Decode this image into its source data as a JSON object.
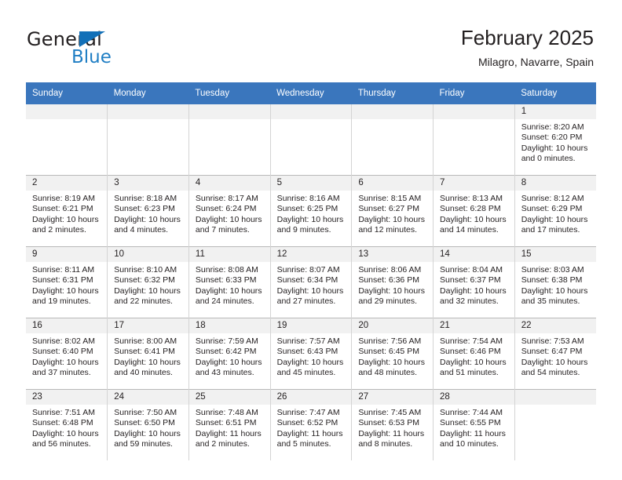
{
  "brand": {
    "name_part1": "General",
    "name_part2": "Blue",
    "triangle_icon": "blue-triangle-icon",
    "color_primary": "#1270b8",
    "color_secondary": "#1f7ec4"
  },
  "header": {
    "title": "February 2025",
    "subtitle": "Milagro, Navarre, Spain"
  },
  "calendar": {
    "header_bg": "#3a76bd",
    "header_text_color": "#ffffff",
    "daynum_bg": "#f1f1f1",
    "weekdays": [
      "Sunday",
      "Monday",
      "Tuesday",
      "Wednesday",
      "Thursday",
      "Friday",
      "Saturday"
    ],
    "labels": {
      "sunrise": "Sunrise:",
      "sunset": "Sunset:",
      "daylight": "Daylight:"
    },
    "weeks": [
      [
        {
          "day": "",
          "blank": true,
          "sunrise": "",
          "sunset": "",
          "daylight_line1": "",
          "daylight_line2": ""
        },
        {
          "day": "",
          "blank": true,
          "sunrise": "",
          "sunset": "",
          "daylight_line1": "",
          "daylight_line2": ""
        },
        {
          "day": "",
          "blank": true,
          "sunrise": "",
          "sunset": "",
          "daylight_line1": "",
          "daylight_line2": ""
        },
        {
          "day": "",
          "blank": true,
          "sunrise": "",
          "sunset": "",
          "daylight_line1": "",
          "daylight_line2": ""
        },
        {
          "day": "",
          "blank": true,
          "sunrise": "",
          "sunset": "",
          "daylight_line1": "",
          "daylight_line2": ""
        },
        {
          "day": "",
          "blank": true,
          "sunrise": "",
          "sunset": "",
          "daylight_line1": "",
          "daylight_line2": ""
        },
        {
          "day": "1",
          "blank": false,
          "sunrise": "Sunrise: 8:20 AM",
          "sunset": "Sunset: 6:20 PM",
          "daylight_line1": "Daylight: 10 hours",
          "daylight_line2": "and 0 minutes."
        }
      ],
      [
        {
          "day": "2",
          "blank": false,
          "sunrise": "Sunrise: 8:19 AM",
          "sunset": "Sunset: 6:21 PM",
          "daylight_line1": "Daylight: 10 hours",
          "daylight_line2": "and 2 minutes."
        },
        {
          "day": "3",
          "blank": false,
          "sunrise": "Sunrise: 8:18 AM",
          "sunset": "Sunset: 6:23 PM",
          "daylight_line1": "Daylight: 10 hours",
          "daylight_line2": "and 4 minutes."
        },
        {
          "day": "4",
          "blank": false,
          "sunrise": "Sunrise: 8:17 AM",
          "sunset": "Sunset: 6:24 PM",
          "daylight_line1": "Daylight: 10 hours",
          "daylight_line2": "and 7 minutes."
        },
        {
          "day": "5",
          "blank": false,
          "sunrise": "Sunrise: 8:16 AM",
          "sunset": "Sunset: 6:25 PM",
          "daylight_line1": "Daylight: 10 hours",
          "daylight_line2": "and 9 minutes."
        },
        {
          "day": "6",
          "blank": false,
          "sunrise": "Sunrise: 8:15 AM",
          "sunset": "Sunset: 6:27 PM",
          "daylight_line1": "Daylight: 10 hours",
          "daylight_line2": "and 12 minutes."
        },
        {
          "day": "7",
          "blank": false,
          "sunrise": "Sunrise: 8:13 AM",
          "sunset": "Sunset: 6:28 PM",
          "daylight_line1": "Daylight: 10 hours",
          "daylight_line2": "and 14 minutes."
        },
        {
          "day": "8",
          "blank": false,
          "sunrise": "Sunrise: 8:12 AM",
          "sunset": "Sunset: 6:29 PM",
          "daylight_line1": "Daylight: 10 hours",
          "daylight_line2": "and 17 minutes."
        }
      ],
      [
        {
          "day": "9",
          "blank": false,
          "sunrise": "Sunrise: 8:11 AM",
          "sunset": "Sunset: 6:31 PM",
          "daylight_line1": "Daylight: 10 hours",
          "daylight_line2": "and 19 minutes."
        },
        {
          "day": "10",
          "blank": false,
          "sunrise": "Sunrise: 8:10 AM",
          "sunset": "Sunset: 6:32 PM",
          "daylight_line1": "Daylight: 10 hours",
          "daylight_line2": "and 22 minutes."
        },
        {
          "day": "11",
          "blank": false,
          "sunrise": "Sunrise: 8:08 AM",
          "sunset": "Sunset: 6:33 PM",
          "daylight_line1": "Daylight: 10 hours",
          "daylight_line2": "and 24 minutes."
        },
        {
          "day": "12",
          "blank": false,
          "sunrise": "Sunrise: 8:07 AM",
          "sunset": "Sunset: 6:34 PM",
          "daylight_line1": "Daylight: 10 hours",
          "daylight_line2": "and 27 minutes."
        },
        {
          "day": "13",
          "blank": false,
          "sunrise": "Sunrise: 8:06 AM",
          "sunset": "Sunset: 6:36 PM",
          "daylight_line1": "Daylight: 10 hours",
          "daylight_line2": "and 29 minutes."
        },
        {
          "day": "14",
          "blank": false,
          "sunrise": "Sunrise: 8:04 AM",
          "sunset": "Sunset: 6:37 PM",
          "daylight_line1": "Daylight: 10 hours",
          "daylight_line2": "and 32 minutes."
        },
        {
          "day": "15",
          "blank": false,
          "sunrise": "Sunrise: 8:03 AM",
          "sunset": "Sunset: 6:38 PM",
          "daylight_line1": "Daylight: 10 hours",
          "daylight_line2": "and 35 minutes."
        }
      ],
      [
        {
          "day": "16",
          "blank": false,
          "sunrise": "Sunrise: 8:02 AM",
          "sunset": "Sunset: 6:40 PM",
          "daylight_line1": "Daylight: 10 hours",
          "daylight_line2": "and 37 minutes."
        },
        {
          "day": "17",
          "blank": false,
          "sunrise": "Sunrise: 8:00 AM",
          "sunset": "Sunset: 6:41 PM",
          "daylight_line1": "Daylight: 10 hours",
          "daylight_line2": "and 40 minutes."
        },
        {
          "day": "18",
          "blank": false,
          "sunrise": "Sunrise: 7:59 AM",
          "sunset": "Sunset: 6:42 PM",
          "daylight_line1": "Daylight: 10 hours",
          "daylight_line2": "and 43 minutes."
        },
        {
          "day": "19",
          "blank": false,
          "sunrise": "Sunrise: 7:57 AM",
          "sunset": "Sunset: 6:43 PM",
          "daylight_line1": "Daylight: 10 hours",
          "daylight_line2": "and 45 minutes."
        },
        {
          "day": "20",
          "blank": false,
          "sunrise": "Sunrise: 7:56 AM",
          "sunset": "Sunset: 6:45 PM",
          "daylight_line1": "Daylight: 10 hours",
          "daylight_line2": "and 48 minutes."
        },
        {
          "day": "21",
          "blank": false,
          "sunrise": "Sunrise: 7:54 AM",
          "sunset": "Sunset: 6:46 PM",
          "daylight_line1": "Daylight: 10 hours",
          "daylight_line2": "and 51 minutes."
        },
        {
          "day": "22",
          "blank": false,
          "sunrise": "Sunrise: 7:53 AM",
          "sunset": "Sunset: 6:47 PM",
          "daylight_line1": "Daylight: 10 hours",
          "daylight_line2": "and 54 minutes."
        }
      ],
      [
        {
          "day": "23",
          "blank": false,
          "sunrise": "Sunrise: 7:51 AM",
          "sunset": "Sunset: 6:48 PM",
          "daylight_line1": "Daylight: 10 hours",
          "daylight_line2": "and 56 minutes."
        },
        {
          "day": "24",
          "blank": false,
          "sunrise": "Sunrise: 7:50 AM",
          "sunset": "Sunset: 6:50 PM",
          "daylight_line1": "Daylight: 10 hours",
          "daylight_line2": "and 59 minutes."
        },
        {
          "day": "25",
          "blank": false,
          "sunrise": "Sunrise: 7:48 AM",
          "sunset": "Sunset: 6:51 PM",
          "daylight_line1": "Daylight: 11 hours",
          "daylight_line2": "and 2 minutes."
        },
        {
          "day": "26",
          "blank": false,
          "sunrise": "Sunrise: 7:47 AM",
          "sunset": "Sunset: 6:52 PM",
          "daylight_line1": "Daylight: 11 hours",
          "daylight_line2": "and 5 minutes."
        },
        {
          "day": "27",
          "blank": false,
          "sunrise": "Sunrise: 7:45 AM",
          "sunset": "Sunset: 6:53 PM",
          "daylight_line1": "Daylight: 11 hours",
          "daylight_line2": "and 8 minutes."
        },
        {
          "day": "28",
          "blank": false,
          "sunrise": "Sunrise: 7:44 AM",
          "sunset": "Sunset: 6:55 PM",
          "daylight_line1": "Daylight: 11 hours",
          "daylight_line2": "and 10 minutes."
        },
        {
          "day": "",
          "blank": true,
          "sunrise": "",
          "sunset": "",
          "daylight_line1": "",
          "daylight_line2": ""
        }
      ]
    ]
  }
}
